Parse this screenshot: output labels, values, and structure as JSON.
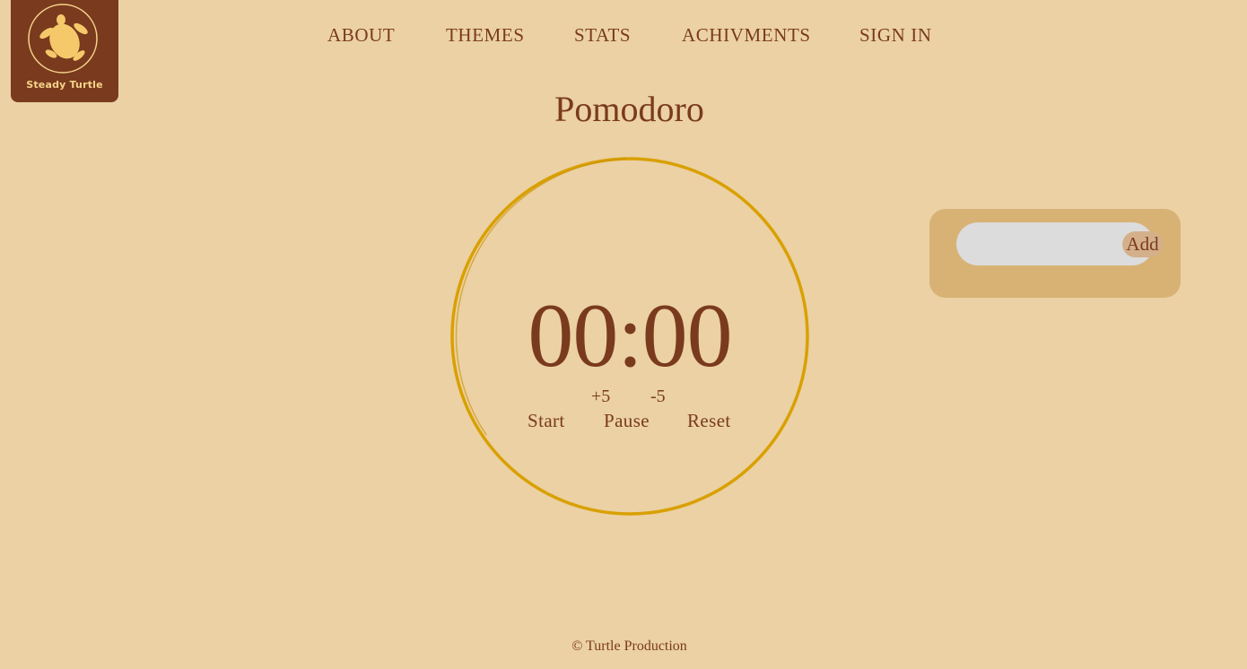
{
  "brand": {
    "logo_icon": "turtle-icon",
    "name": "Steady Turtle"
  },
  "nav": {
    "items": [
      "ABOUT",
      "THEMES",
      "STATS",
      "ACHIVMENTS",
      "SIGN IN"
    ]
  },
  "main": {
    "title": "Pomodoro",
    "timer": "00:00",
    "adjust": {
      "plus": "+5",
      "minus": "-5"
    },
    "controls": {
      "start": "Start",
      "pause": "Pause",
      "reset": "Reset"
    }
  },
  "tasks": {
    "input_value": "",
    "add_label": "Add"
  },
  "footer": {
    "text": "© Turtle Production"
  },
  "colors": {
    "background": "#ebd1a3",
    "primary": "#7a3a1e",
    "ring": "#d9a000",
    "panel": "#d8b275",
    "logo_accent": "#f5d48a"
  }
}
